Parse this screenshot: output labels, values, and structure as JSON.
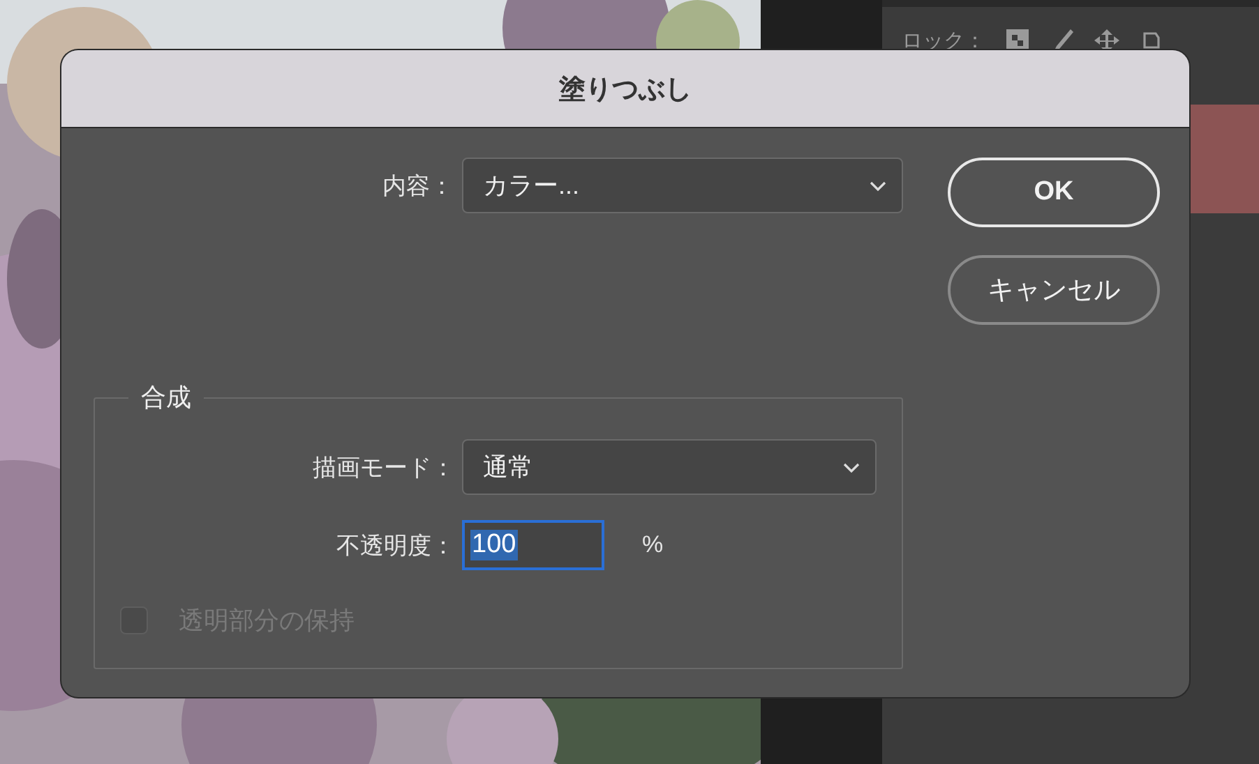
{
  "panel": {
    "lock_label": "ロック："
  },
  "dialog": {
    "title": "塗りつぶし",
    "content": {
      "label": "内容：",
      "value": "カラー..."
    },
    "buttons": [
      {
        "label": "OK",
        "default": true
      },
      {
        "label": "キャンセル",
        "default": false
      }
    ],
    "blending": {
      "title": "合成",
      "mode": {
        "label": "描画モード：",
        "value": "通常"
      },
      "opacity": {
        "label": "不透明度：",
        "value": "100",
        "unit": "%",
        "selected": true
      },
      "preserve_transparency": {
        "label": "透明部分の保持",
        "checked": false,
        "disabled": true
      }
    }
  }
}
